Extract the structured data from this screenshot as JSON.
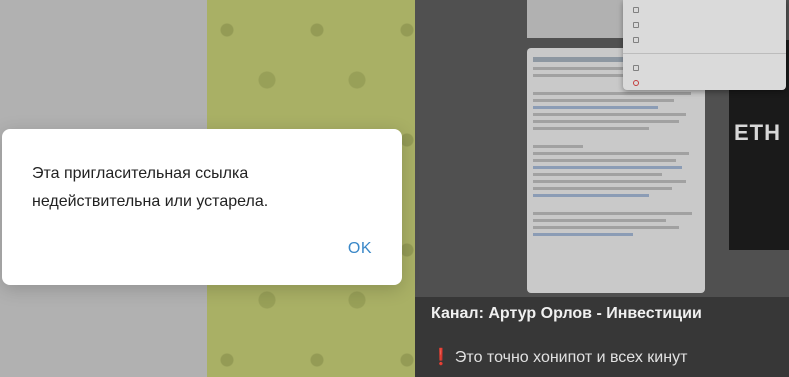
{
  "dialog": {
    "message": "Эта пригласительная ссылка недействительна или устарела.",
    "ok_label": "OK"
  },
  "channel": {
    "title": "Канал: Артур Орлов - Инвестиции",
    "message_icon": "exclamation-icon",
    "message_text": "Это точно хонипот и всех кинут"
  },
  "colors": {
    "accent": "#3a88c8",
    "dialog_bg": "#ffffff",
    "caption_bg": "#3b3b3b",
    "warning": "#e53935"
  }
}
